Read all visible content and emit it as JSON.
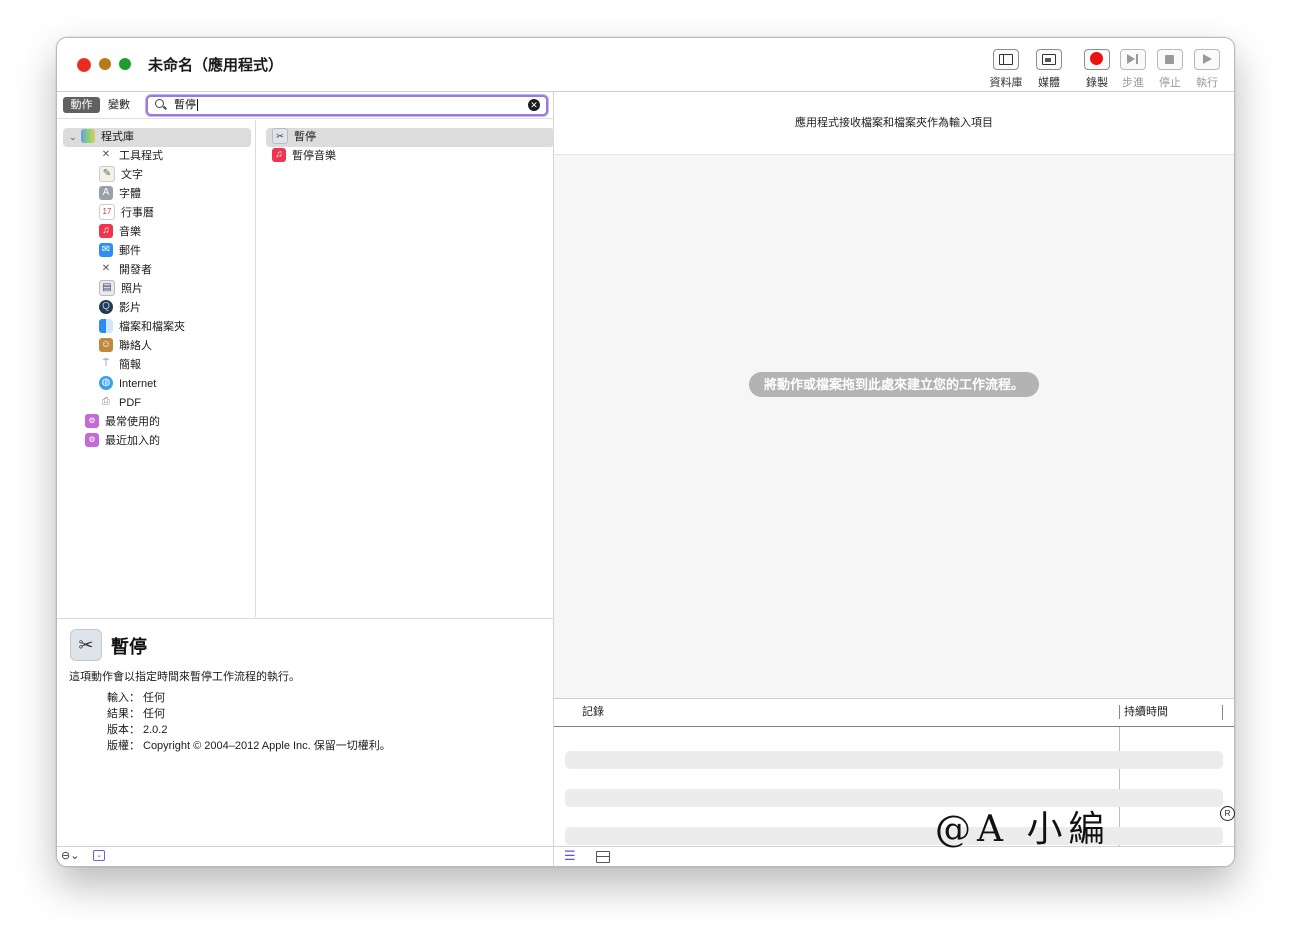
{
  "window": {
    "title": "未命名（應用程式）"
  },
  "toolbar": {
    "library": "資料庫",
    "media": "媒體",
    "record": "錄製",
    "step": "步進",
    "stop": "停止",
    "run": "執行"
  },
  "tabs": {
    "actions": "動作",
    "variables": "變數"
  },
  "search": {
    "value": "暫停"
  },
  "library_tree": {
    "root": "程式庫",
    "items": [
      {
        "label": "工具程式",
        "icon": "tools-icon"
      },
      {
        "label": "文字",
        "icon": "text-icon"
      },
      {
        "label": "字體",
        "icon": "fonts-icon"
      },
      {
        "label": "行事曆",
        "icon": "calendar-icon"
      },
      {
        "label": "音樂",
        "icon": "music-icon"
      },
      {
        "label": "郵件",
        "icon": "mail-icon"
      },
      {
        "label": "開發者",
        "icon": "developer-icon"
      },
      {
        "label": "照片",
        "icon": "photos-icon"
      },
      {
        "label": "影片",
        "icon": "movies-icon"
      },
      {
        "label": "檔案和檔案夾",
        "icon": "finder-icon"
      },
      {
        "label": "聯絡人",
        "icon": "contacts-icon"
      },
      {
        "label": "簡報",
        "icon": "presentation-icon"
      },
      {
        "label": "Internet",
        "icon": "globe-icon"
      },
      {
        "label": "PDF",
        "icon": "pdf-icon"
      }
    ],
    "smart_groups": [
      "最常使用的",
      "最近加入的"
    ]
  },
  "actions_list": [
    {
      "label": "暫停",
      "icon": "pause-action-icon",
      "selected": true
    },
    {
      "label": "暫停音樂",
      "icon": "music-icon",
      "selected": false
    }
  ],
  "description": {
    "title": "暫停",
    "text": "這項動作會以指定時間來暫停工作流程的執行。",
    "input_key": "輸入：",
    "input_value": "任何",
    "result_key": "結果：",
    "result_value": "任何",
    "version_key": "版本：",
    "version_value": "2.0.2",
    "copyright_key": "版權：",
    "copyright_value": "Copyright © 2004–2012 Apple Inc. 保留一切權利。"
  },
  "workflow": {
    "input_info": "應用程式接收檔案和檔案夾作為輸入項目",
    "hint": "將動作或檔案拖到此處來建立您的工作流程。"
  },
  "log": {
    "col_log": "記錄",
    "col_duration": "持續時間"
  },
  "watermark": {
    "text": "@A 小編",
    "mark": "R"
  },
  "colors": {
    "accent": "#9a7bd6",
    "record": "#ee1111"
  }
}
